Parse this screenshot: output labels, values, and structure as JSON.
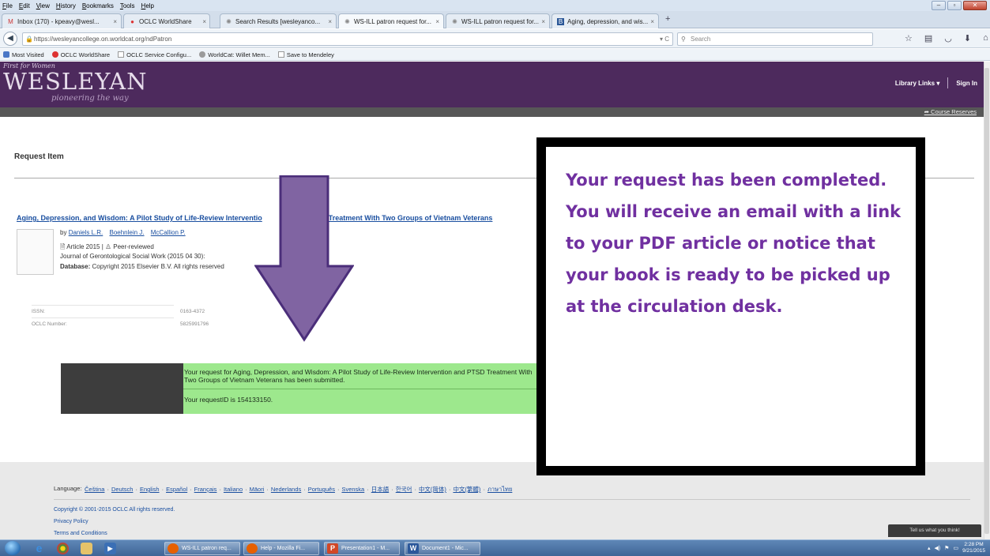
{
  "browser": {
    "menu": [
      "File",
      "Edit",
      "View",
      "History",
      "Bookmarks",
      "Tools",
      "Help"
    ],
    "tabs": [
      {
        "label": "Inbox (170) - kpeavy@wesl...",
        "icon": "gmail-icon"
      },
      {
        "label": "OCLC WorldShare",
        "icon": "oclc-icon"
      },
      {
        "label": "Search Results [wesleyanco...",
        "icon": "worldcat-icon"
      },
      {
        "label": "WS-ILL patron request for...",
        "icon": "worldcat-icon"
      },
      {
        "label": "WS-ILL patron request for...",
        "icon": "worldcat-icon"
      },
      {
        "label": "Aging, depression, and wis...",
        "icon": "book-icon"
      }
    ],
    "url": "https://wesleyancollege.on.worldcat.org/ndPatron",
    "search_placeholder": "Search",
    "bookmarks": [
      "Most Visited",
      "OCLC WorldShare",
      "OCLC Service Configu...",
      "WorldCat: Willet Mem...",
      "Save to Mendeley"
    ]
  },
  "site": {
    "tagline": "First for Women",
    "logo": "WESLEYAN",
    "motto": "pioneering the way",
    "library_links": "Library Links",
    "sign_in": "Sign In",
    "course_reserves": "Course Reserves"
  },
  "request": {
    "heading": "Request Item",
    "article_title": "Aging, Depression, and Wisdom: A Pilot Study of Life-Review Interventio",
    "article_title_tail": "Treatment With Two Groups of Vietnam Veterans",
    "by": "by",
    "authors": [
      "Daniels L.R.",
      "Boehnlein J.",
      "McCallion P."
    ],
    "type_line": "Article 2015",
    "peer_reviewed": "Peer-reviewed",
    "journal": "Journal of Gerontological Social Work (2015 04 30):",
    "database_label": "Database:",
    "database_value": "Copyright 2015 Elsevier B.V. All rights reserved",
    "issn_label": "ISSN:",
    "issn_value": "0163-4372",
    "oclc_label": "OCLC Number:",
    "oclc_value": "5825991796"
  },
  "confirmation": {
    "message": "Your request for Aging, Depression, and Wisdom: A Pilot Study of Life-Review Intervention and PTSD Treatment With Two Groups of Vietnam Veterans has been submitted.",
    "request_id": "Your requestID is 154133150."
  },
  "callout": {
    "text": "Your request has been completed. You will receive an email with a link to your PDF article or notice that your book is ready to be picked up at the circulation desk.",
    "color": "#7030a0"
  },
  "footer": {
    "language_label": "Language:",
    "languages": [
      "Čeština",
      "Deutsch",
      "English",
      "Español",
      "Français",
      "Italiano",
      "Māori",
      "Nederlands",
      "Português",
      "Svenska",
      "日本語",
      "한국어",
      "中文(简体)",
      "中文(繁體)",
      "ภาษาไทย"
    ],
    "copyright": "Copyright © 2001-2015 OCLC All rights reserved.",
    "privacy": "Privacy Policy",
    "terms": "Terms and Conditions",
    "feedback": "Tell us what you think!"
  },
  "taskbar": {
    "items": [
      "WS-ILL patron req...",
      "Help - Mozilla Fi...",
      "Presentation1 - M...",
      "Document1 - Mic..."
    ],
    "time": "2:28 PM",
    "date": "9/21/2015"
  },
  "colors": {
    "header_purple": "#4d2a5d",
    "success_green": "#9de88d",
    "link_blue": "#1a4fa0"
  }
}
